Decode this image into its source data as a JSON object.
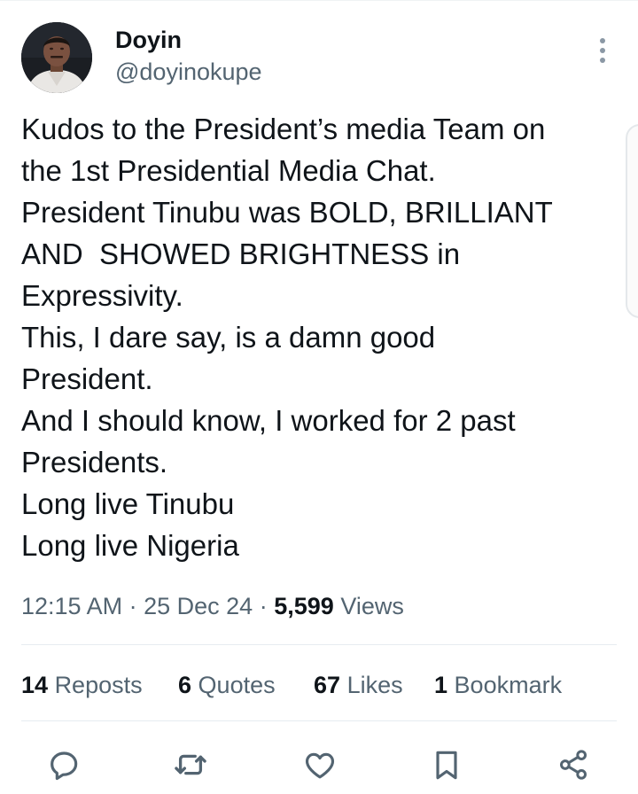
{
  "author": {
    "display_name": "Doyin",
    "handle": "@doyinokupe",
    "avatar": "profile-photo"
  },
  "tweet": {
    "lines": [
      "Kudos to the President’s media Team on",
      "the 1st Presidential Media Chat.",
      "President Tinubu was BOLD, BRILLIANT",
      "AND  SHOWED BRIGHTNESS in",
      "Expressivity.",
      "This, I dare say, is a damn good",
      "President.",
      "And I should know, I worked for 2 past",
      "Presidents.",
      "Long live Tinubu",
      "Long live Nigeria"
    ]
  },
  "meta": {
    "time": "12:15 AM",
    "separator": "·",
    "date": "25 Dec 24",
    "views_count": "5,599",
    "views_label": "Views"
  },
  "stats": {
    "reposts": {
      "count": "14",
      "label": "Reposts"
    },
    "quotes": {
      "count": "6",
      "label": "Quotes"
    },
    "likes": {
      "count": "67",
      "label": "Likes"
    },
    "bookmarks": {
      "count": "1",
      "label": "Bookmark"
    }
  },
  "actions": [
    {
      "name": "reply",
      "icon": "speech-bubble-icon"
    },
    {
      "name": "repost",
      "icon": "repost-arrows-icon"
    },
    {
      "name": "like",
      "icon": "heart-icon"
    },
    {
      "name": "bookmark",
      "icon": "bookmark-icon"
    },
    {
      "name": "share",
      "icon": "share-nodes-icon"
    }
  ],
  "colors": {
    "text_primary": "#0f1419",
    "text_secondary": "#536471",
    "divider": "#e6ecf0",
    "icon": "#536471"
  }
}
